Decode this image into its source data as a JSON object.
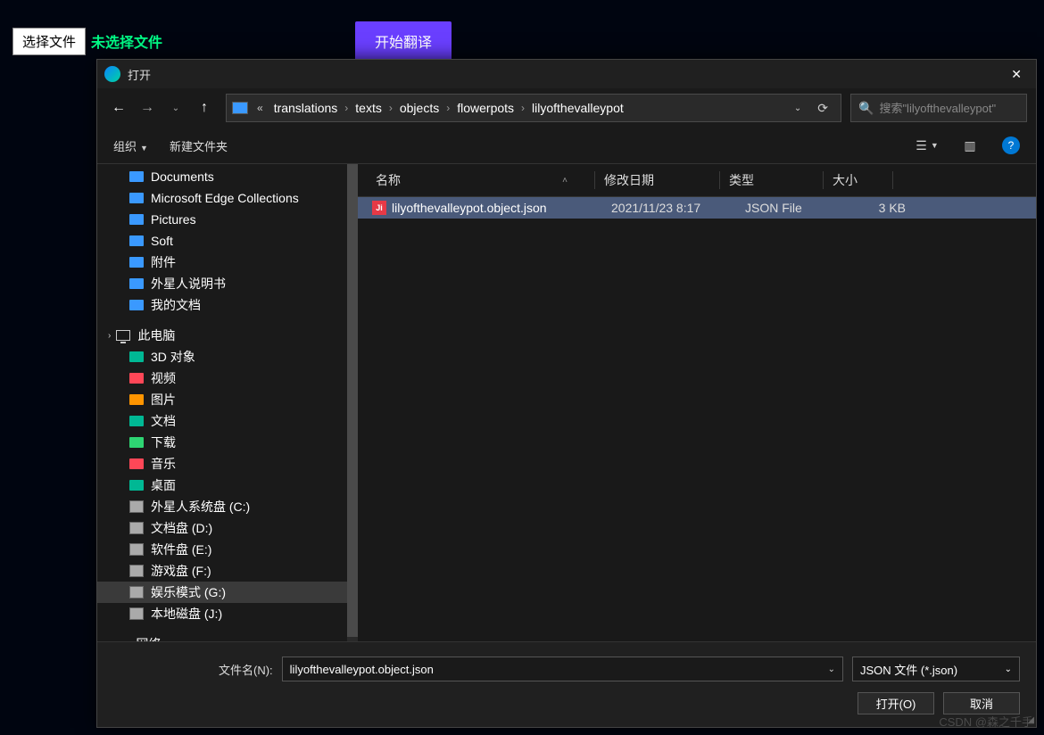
{
  "topBar": {
    "selectFile": "选择文件",
    "noFile": "未选择文件",
    "translate": "开始翻译"
  },
  "dialog": {
    "title": "打开",
    "breadcrumbs": [
      "translations",
      "texts",
      "objects",
      "flowerpots",
      "lilyofthevalleypot"
    ],
    "searchPlaceholder": "搜索\"lilyofthevalleypot\"",
    "toolbar": {
      "organize": "组织",
      "newFolder": "新建文件夹"
    },
    "tree": [
      {
        "label": "Documents",
        "icon": "blue",
        "indent": 1
      },
      {
        "label": "Microsoft Edge Collections",
        "icon": "blue",
        "indent": 1
      },
      {
        "label": "Pictures",
        "icon": "blue",
        "indent": 1
      },
      {
        "label": "Soft",
        "icon": "blue",
        "indent": 1
      },
      {
        "label": "附件",
        "icon": "blue",
        "indent": 1
      },
      {
        "label": "外星人说明书",
        "icon": "blue",
        "indent": 1
      },
      {
        "label": "我的文档",
        "icon": "blue",
        "indent": 1
      },
      {
        "label": "此电脑",
        "icon": "monitor",
        "indent": 0,
        "chev": true
      },
      {
        "label": "3D 对象",
        "icon": "teal",
        "indent": 1
      },
      {
        "label": "视频",
        "icon": "red",
        "indent": 1
      },
      {
        "label": "图片",
        "icon": "orange",
        "indent": 1
      },
      {
        "label": "文档",
        "icon": "teal",
        "indent": 1
      },
      {
        "label": "下载",
        "icon": "green",
        "indent": 1
      },
      {
        "label": "音乐",
        "icon": "red",
        "indent": 1
      },
      {
        "label": "桌面",
        "icon": "teal",
        "indent": 1
      },
      {
        "label": "外星人系统盘 (C:)",
        "icon": "disk",
        "indent": 1
      },
      {
        "label": "文档盘 (D:)",
        "icon": "disk",
        "indent": 1
      },
      {
        "label": "软件盘 (E:)",
        "icon": "disk",
        "indent": 1
      },
      {
        "label": "游戏盘 (F:)",
        "icon": "disk",
        "indent": 1
      },
      {
        "label": "娱乐模式 (G:)",
        "icon": "disk",
        "indent": 1,
        "selected": true
      },
      {
        "label": "本地磁盘 (J:)",
        "icon": "disk",
        "indent": 1
      },
      {
        "label": "网络",
        "icon": "net",
        "indent": 0,
        "chev": true
      }
    ],
    "columns": {
      "name": "名称",
      "date": "修改日期",
      "type": "类型",
      "size": "大小"
    },
    "files": [
      {
        "name": "lilyofthevalleypot.object.json",
        "date": "2021/11/23  8:17",
        "type": "JSON File",
        "size": "3 KB",
        "selected": true
      }
    ],
    "footer": {
      "filenameLabel": "文件名(N):",
      "filenameValue": "lilyofthevalleypot.object.json",
      "typeFilter": "JSON 文件 (*.json)",
      "open": "打开(O)",
      "cancel": "取消"
    }
  },
  "watermark": "CSDN @森之千手"
}
